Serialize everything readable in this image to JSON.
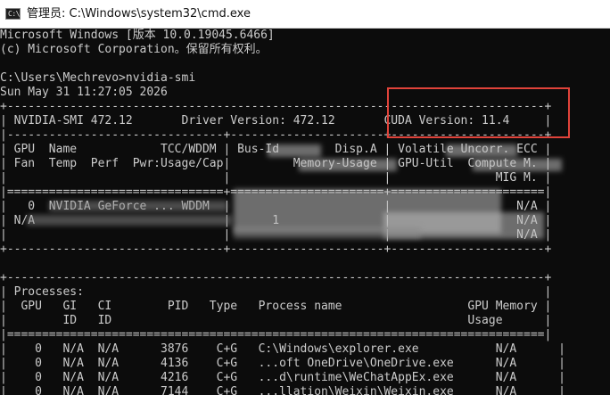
{
  "window": {
    "title": "管理员: C:\\Windows\\system32\\cmd.exe",
    "icon": "cmd-icon",
    "icon_prompt": "C:\\"
  },
  "console_lines": [
    "Microsoft Windows [版本 10.0.19045.6466]",
    "(c) Microsoft Corporation。保留所有权利。",
    "",
    "C:\\Users\\Mechrevo>nvidia-smi",
    "Sun May 31 11:27:05 2026",
    "+-----------------------------------------------------------------------------+",
    "| NVIDIA-SMI 472.12       Driver Version: 472.12       CUDA Version: 11.4     |",
    "|-------------------------------+----------------------+----------------------+",
    "| GPU  Name            TCC/WDDM | Bus-Id        Disp.A | Volatile Uncorr. ECC |",
    "| Fan  Temp  Perf  Pwr:Usage/Cap|         Memory-Usage | GPU-Util  Compute M. |",
    "|                               |                      |               MIG M. |",
    "|===============================+======================+======================|",
    "|   0  NVIDIA GeForce ... WDDM  |                      |                  N/A |",
    "| N/A                           |      1               |                  N/A |",
    "|                               |                      |                  N/A |",
    "+-------------------------------+----------------------+----------------------+",
    "",
    "+-----------------------------------------------------------------------------+",
    "| Processes:                                                                  |",
    "|  GPU   GI   CI        PID   Type   Process name                  GPU Memory |",
    "|        ID   ID                                                   Usage      |",
    "|=============================================================================|",
    "|    0   N/A  N/A      3876    C+G   C:\\Windows\\explorer.exe           N/A      |",
    "|    0   N/A  N/A      4136    C+G   ...oft OneDrive\\OneDrive.exe      N/A      |",
    "|    0   N/A  N/A      4216    C+G   ...d\\runtime\\WeChatAppEx.exe      N/A      |",
    "|    0   N/A  N/A      7144    C+G   ...llation\\Weixin\\Weixin.exe      N/A      |"
  ],
  "highlight": {
    "color": "#e0433a",
    "label": "CUDA Version: 11.4"
  }
}
